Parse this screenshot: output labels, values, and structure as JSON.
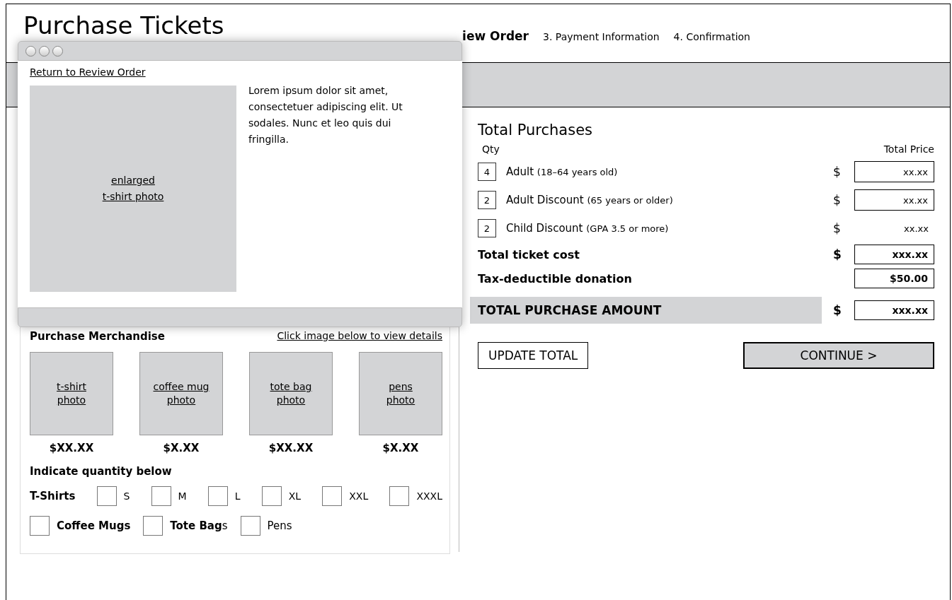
{
  "page": {
    "title": "Purchase Tickets"
  },
  "steps": [
    {
      "label": "iew Order",
      "selected": true
    },
    {
      "label": "3. Payment Information",
      "selected": false
    },
    {
      "label": "4. Confirmation",
      "selected": false
    }
  ],
  "merchandise": {
    "title": "Purchase Merchandise",
    "hint": "Click image below to view details",
    "items": [
      {
        "label": "t-shirt\nphoto",
        "price": "$XX.XX"
      },
      {
        "label": "coffee mug\nphoto",
        "price": "$X.XX"
      },
      {
        "label": "tote bag\nphoto",
        "price": "$XX.XX"
      },
      {
        "label": "pens\nphoto",
        "price": "$X.XX"
      }
    ],
    "quantity_title": "Indicate quantity below",
    "tshirt_label": "T-Shirts",
    "sizes": [
      "S",
      "M",
      "L",
      "XL",
      "XXL",
      "XXXL"
    ],
    "others": [
      {
        "label": "Coffee Mugs",
        "bold": true
      },
      {
        "label": "**Tote Bag**s",
        "bold": false
      },
      {
        "label": "Pens",
        "bold": false
      }
    ]
  },
  "totals": {
    "title": "Total Purchases",
    "qty_header": "Qty",
    "price_header": "Total Price",
    "tickets": [
      {
        "qty": "4",
        "name": "Adult",
        "note": "(18–64 years old)",
        "currency": "$",
        "price": "xx.xx",
        "boxed": true
      },
      {
        "qty": "2",
        "name": "Adult Discount",
        "note": "(65 years or older)",
        "currency": "$",
        "price": "xx.xx",
        "boxed": true
      },
      {
        "qty": "2",
        "name": "Child Discount",
        "note": "(GPA 3.5 or more)",
        "currency": "$",
        "price": "xx.xx",
        "boxed": false
      }
    ],
    "summary": [
      {
        "kind": "plain",
        "label": "Total ticket cost",
        "currency": "$",
        "value": "xxx.xx"
      },
      {
        "kind": "plain",
        "label": "Tax-deductible donation",
        "value": "$50.00"
      },
      {
        "kind": "grand",
        "label": "TOTAL PURCHASE AMOUNT",
        "currency": "$",
        "value": "xxx.xx"
      }
    ],
    "buttons": [
      {
        "label": "UPDATE TOTAL",
        "kind": "secondary"
      },
      {
        "label": "CONTINUE >",
        "kind": "primary"
      }
    ]
  },
  "modal": {
    "link": "Return to Review Order",
    "image_label": "enlarged\nt-shirt photo",
    "description": "Lorem ipsum dolor sit amet, consectetuer adipiscing elit. Ut sodales. Nunc et leo quis dui fringilla."
  }
}
